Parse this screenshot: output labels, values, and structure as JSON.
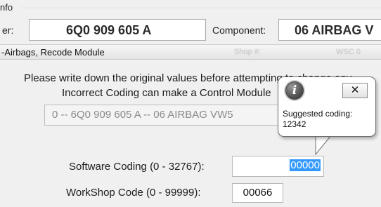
{
  "group": {
    "caption": "nfo"
  },
  "header": {
    "part_label": "er:",
    "part_value": "6Q0 909 605 A",
    "component_label": "Component:",
    "component_value": "06 AIRBAG V"
  },
  "strip": {
    "title": "-Airbags,  Recode Module",
    "faint_1": "Shop #:",
    "faint_2": "WSC 0"
  },
  "warning": {
    "line1": "Please write down the original values before attempting to change any",
    "line2": "Incorrect Coding can make a Control Module"
  },
  "combo": {
    "value": "0 -- 6Q0 909 605 A -- 06 AIRBAG VW5"
  },
  "form": {
    "software_coding_label": "Software Coding (0 - 32767):",
    "software_coding_value": "00000",
    "workshop_code_label": "WorkShop Code (0 - 99999):",
    "workshop_code_value": "00066"
  },
  "balloon": {
    "close_label": "✕",
    "info_glyph": "i",
    "title": "Suggested coding:",
    "value": "12342"
  }
}
